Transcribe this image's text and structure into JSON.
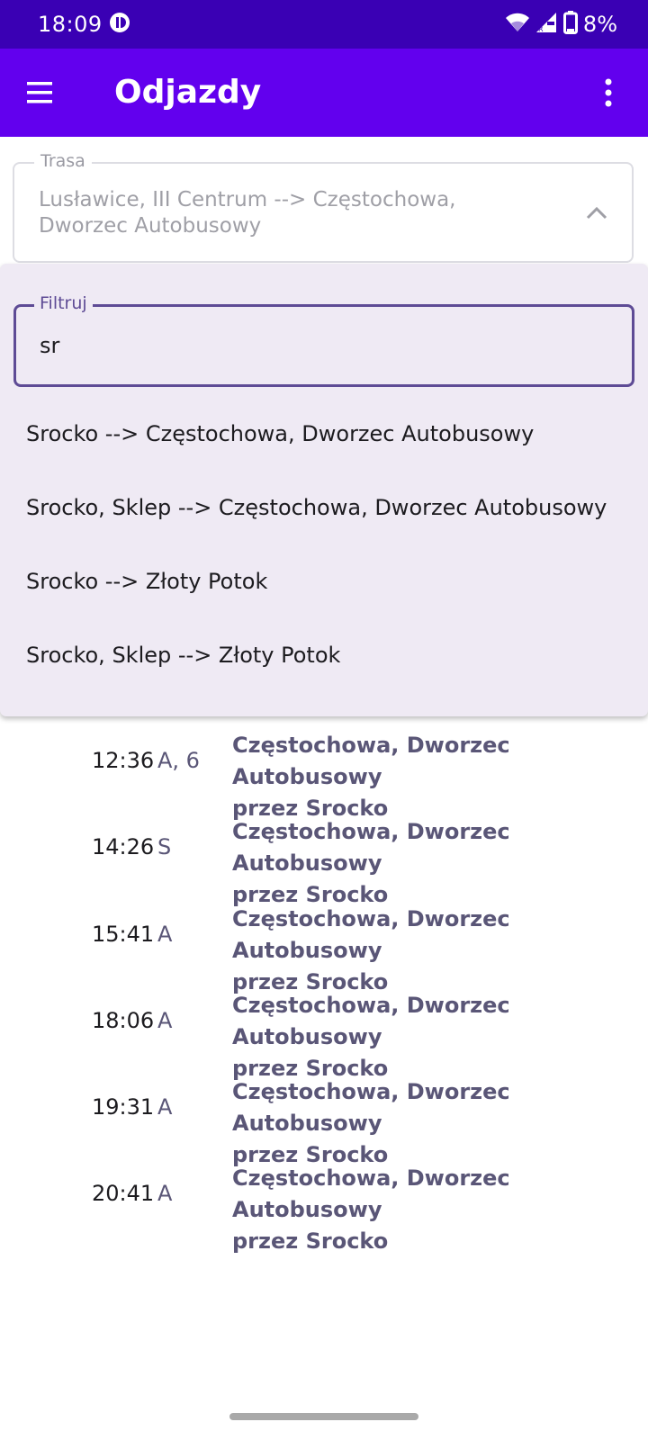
{
  "status_bar": {
    "time": "18:09",
    "battery": "8%",
    "left_icon": "app-notification-icon",
    "right_icons": [
      "wifi-icon",
      "signal-icon",
      "battery-icon"
    ]
  },
  "app_bar": {
    "title": "Odjazdy",
    "menu_icon": "hamburger-menu-icon",
    "overflow_icon": "more-vert-icon",
    "color": "#6200ee"
  },
  "route": {
    "label": "Trasa",
    "value": "Lusławice, III Centrum --> Częstochowa, Dworzec Autobusowy"
  },
  "filter": {
    "label": "Filtruj",
    "value": "sr"
  },
  "dropdown_options": [
    "Srocko --> Częstochowa, Dworzec Autobusowy",
    "Srocko, Sklep --> Częstochowa, Dworzec Autobusowy",
    "Srocko --> Złoty Potok",
    "Srocko, Sklep --> Złoty Potok"
  ],
  "departures": [
    {
      "time": "12:36",
      "note": "A, 6",
      "destination": "Częstochowa, Dworzec Autobusowy",
      "via": "przez Srocko"
    },
    {
      "time": "14:26",
      "note": "S",
      "destination": "Częstochowa, Dworzec Autobusowy",
      "via": "przez Srocko"
    },
    {
      "time": "15:41",
      "note": "A",
      "destination": "Częstochowa, Dworzec Autobusowy",
      "via": "przez Srocko"
    },
    {
      "time": "18:06",
      "note": "A",
      "destination": "Częstochowa, Dworzec Autobusowy",
      "via": "przez Srocko"
    },
    {
      "time": "19:31",
      "note": "A",
      "destination": "Częstochowa, Dworzec Autobusowy",
      "via": "przez Srocko"
    },
    {
      "time": "20:41",
      "note": "A",
      "destination": "Częstochowa, Dworzec Autobusowy",
      "via": "przez Srocko"
    }
  ]
}
